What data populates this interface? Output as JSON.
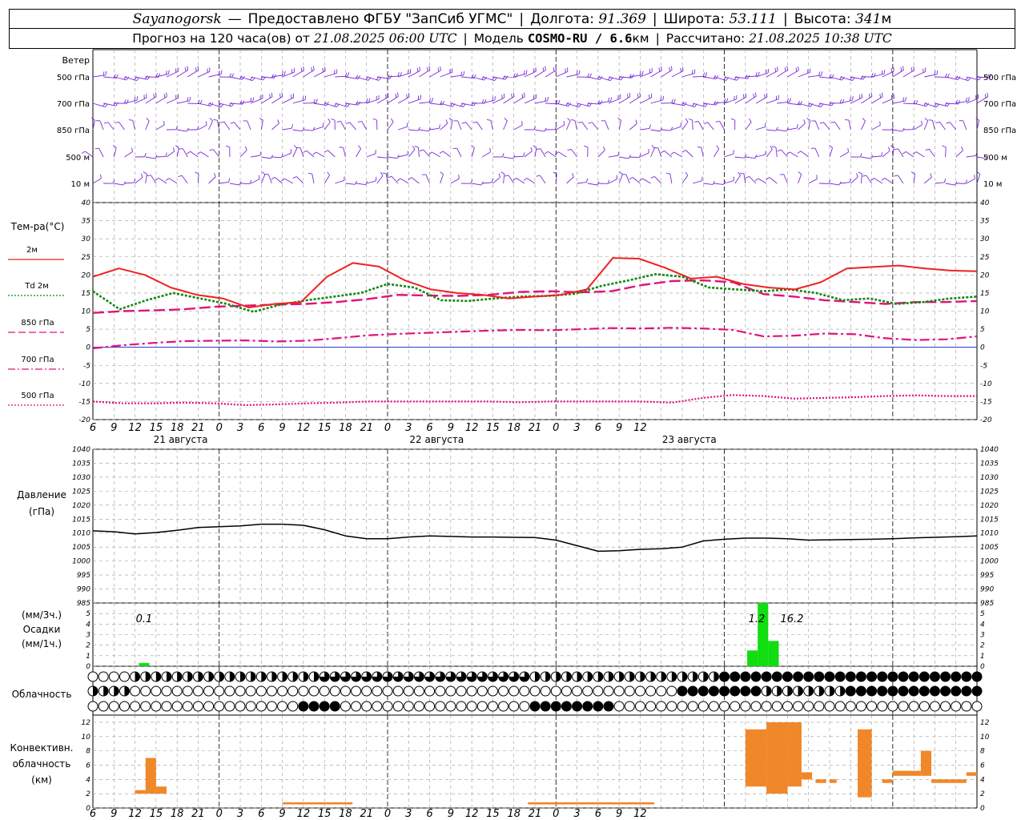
{
  "header": {
    "station": "Sayanogorsk",
    "dash": "—",
    "provider": "Предоставлено ФГБУ \"ЗапСиб УГМС\"",
    "lon_label": "Долгота:",
    "lon_value": "91.369",
    "lat_label": "Широта:",
    "lat_value": "53.111",
    "alt_label": "Высота:",
    "alt_value": "341",
    "alt_unit": "м",
    "forecast_prefix": "Прогноз на 120 часа(ов) от",
    "forecast_start": "21.08.2025 06:00 UTC",
    "model_label": "Модель",
    "model_name": "COSMO-RU / 6.6",
    "model_unit": "км",
    "computed_label": "Рассчитано:",
    "computed_value": "21.08.2025 10:38 UTC"
  },
  "panels": {
    "wind": {
      "title": "Ветер",
      "levels": [
        "500 гПа",
        "700 гПа",
        "850 гПа",
        "500 м",
        "10  м"
      ]
    },
    "temperature": {
      "title": "Тем-ра(°C)",
      "legend": [
        {
          "label": "2м",
          "color": "#ee2222",
          "style": "solid"
        },
        {
          "label": "Td 2м",
          "color": "#118811",
          "style": "dotted"
        },
        {
          "label": "850 гПа",
          "color": "#e0137a",
          "style": "dashed"
        },
        {
          "label": "700 гПа",
          "color": "#e0137a",
          "style": "dashdot"
        },
        {
          "label": "500 гПа",
          "color": "#e0137a",
          "style": "dotted"
        }
      ]
    },
    "pressure": {
      "title": "Давление",
      "unit": "(гПа)"
    },
    "precip": {
      "unit_top": "(мм/3ч.)",
      "title": "Осадки",
      "unit_bottom": "(мм/1ч.)",
      "annotations": [
        "0.1",
        "1.2",
        "16.2"
      ]
    },
    "clouds": {
      "title": "Облачность"
    },
    "convective": {
      "title": [
        "Конвективн.",
        "облачность",
        "(км)"
      ]
    }
  },
  "time_axis": {
    "tick_labels": [
      "6",
      "9",
      "12",
      "15",
      "18",
      "21",
      "0",
      "3",
      "6",
      "9",
      "12",
      "15",
      "18",
      "21",
      "0",
      "3",
      "6",
      "9",
      "12",
      "15",
      "18",
      "21",
      "0",
      "3",
      "6",
      "9",
      "12"
    ],
    "day_labels": [
      "21 августа",
      "22 августа",
      "23 августа"
    ]
  },
  "chart_data": [
    {
      "type": "line",
      "title": "Тем-ра(°C)",
      "ylim": [
        -20,
        40
      ],
      "yticks": [
        -20,
        -15,
        -10,
        -5,
        0,
        5,
        10,
        15,
        20,
        25,
        30,
        35,
        40
      ],
      "x_hours": [
        0,
        3,
        6,
        9,
        12,
        15,
        18,
        21,
        24,
        27,
        30,
        33,
        36,
        39,
        42,
        45,
        48,
        51,
        54,
        57,
        60,
        63,
        66,
        69,
        72,
        75,
        78,
        81,
        84,
        87,
        90,
        93,
        96,
        99,
        102,
        105,
        108,
        111,
        114,
        117,
        120,
        123,
        126
      ],
      "series": [
        {
          "name": "2м",
          "values": [
            19.5,
            21.8,
            20,
            16.5,
            14.5,
            13.5,
            11,
            12,
            12.5,
            19.5,
            23.3,
            22.3,
            18.5,
            16,
            15,
            14.5,
            13.5,
            14,
            14.5,
            16,
            24.7,
            24.5,
            22,
            19,
            19.5,
            17.5,
            16.5,
            16,
            18,
            21.8,
            22.2,
            22.6,
            21.8,
            21.2,
            21
          ]
        },
        {
          "name": "Td 2м",
          "values": [
            15.5,
            10.5,
            13,
            15,
            13.5,
            12,
            9.8,
            11.8,
            13,
            14,
            15,
            17.5,
            16.5,
            13,
            12.8,
            13.5,
            14,
            14.2,
            14.8,
            17,
            18.5,
            20.2,
            19.5,
            16.5,
            16,
            15.5,
            16,
            15,
            13,
            13.5,
            12,
            12.5,
            13.5,
            14
          ]
        },
        {
          "name": "850 гПа",
          "values": [
            9.5,
            10,
            10.2,
            10.5,
            11.2,
            11.5,
            11.8,
            12,
            12.5,
            13.3,
            14.5,
            14.3,
            14.2,
            14.5,
            15.3,
            15.5,
            15.2,
            15.5,
            17.2,
            18.3,
            18.5,
            18,
            14.7,
            14,
            13,
            12.5,
            12,
            12.5,
            12.5,
            12.8
          ]
        },
        {
          "name": "700 гПа",
          "values": [
            -0.3,
            0.6,
            1.2,
            1.7,
            1.8,
            1.9,
            1.6,
            1.8,
            2.5,
            3.3,
            3.7,
            4,
            4.3,
            4.6,
            4.8,
            4.7,
            5,
            5.3,
            5.2,
            5.4,
            5.2,
            4.8,
            3,
            3.2,
            3.8,
            3.6,
            2.5,
            2,
            2.2,
            3
          ]
        },
        {
          "name": "500 гПа",
          "values": [
            -15,
            -15.5,
            -15.5,
            -15.3,
            -15.5,
            -16,
            -15.8,
            -15.5,
            -15.3,
            -15,
            -15,
            -15,
            -15,
            -15,
            -15.2,
            -15,
            -15,
            -15,
            -15,
            -15.3,
            -14,
            -13.2,
            -13.5,
            -14.2,
            -14,
            -13.8,
            -13.5,
            -13.3,
            -13.5,
            -13.5
          ]
        }
      ]
    },
    {
      "type": "line",
      "title": "Давление",
      "ylabel": "(гПа)",
      "ylim": [
        985,
        1040
      ],
      "yticks": [
        985,
        990,
        995,
        1000,
        1005,
        1010,
        1015,
        1020,
        1025,
        1030,
        1035,
        1040
      ],
      "x_hours": [
        0,
        3,
        6,
        9,
        12,
        15,
        18,
        21,
        24,
        27,
        30,
        33,
        36,
        39,
        42,
        45,
        48,
        51,
        54,
        57,
        60,
        63,
        66,
        69,
        72,
        75,
        78,
        81,
        84,
        87,
        90,
        93,
        96,
        99,
        102,
        105,
        108,
        111,
        114,
        117,
        120,
        123,
        126
      ],
      "series": [
        {
          "name": "",
          "values": [
            1010.8,
            1010.5,
            1009.7,
            1010.2,
            1011,
            1012,
            1012.3,
            1012.6,
            1013.2,
            1013.2,
            1012.8,
            1011.2,
            1009,
            1008,
            1008,
            1008.6,
            1009,
            1008.8,
            1008.6,
            1008.6,
            1008.5,
            1008.4,
            1007.5,
            1005.5,
            1003.5,
            1003.7,
            1004.2,
            1004.4,
            1005,
            1007.2,
            1007.8,
            1008.2,
            1008.2,
            1008,
            1007.5,
            1007.6,
            1007.7,
            1007.8,
            1008,
            1008.3,
            1008.5,
            1008.7,
            1009
          ]
        }
      ]
    },
    {
      "type": "bar",
      "title": "Осадки",
      "ylim": [
        0,
        6
      ],
      "yticks": [
        0,
        1,
        2,
        3,
        4,
        5
      ],
      "bars": [
        {
          "hour": 7.3,
          "value": 0.3
        },
        {
          "hour": 94,
          "value": 1.5
        },
        {
          "hour": 95.5,
          "value": 6
        },
        {
          "hour": 97,
          "value": 2.4
        }
      ]
    },
    {
      "type": "bar",
      "title": "Конвективн. облачность (км)",
      "ylim": [
        0,
        13
      ],
      "yticks": [
        0,
        2,
        4,
        6,
        8,
        10,
        12
      ],
      "bars": [
        {
          "hour_from": 6,
          "hour_to": 7.5,
          "bottom": 2,
          "top": 2.5
        },
        {
          "hour_from": 7.5,
          "hour_to": 9,
          "bottom": 2,
          "top": 7
        },
        {
          "hour_from": 9,
          "hour_to": 10.5,
          "bottom": 2,
          "top": 3
        },
        {
          "hour_from": 27,
          "hour_to": 37,
          "bottom": 0.5,
          "top": 0.8
        },
        {
          "hour_from": 62,
          "hour_to": 80,
          "bottom": 0.5,
          "top": 0.8
        },
        {
          "hour_from": 93,
          "hour_to": 96,
          "bottom": 3,
          "top": 11
        },
        {
          "hour_from": 96,
          "hour_to": 99,
          "bottom": 2,
          "top": 12
        },
        {
          "hour_from": 99,
          "hour_to": 101,
          "bottom": 3,
          "top": 12
        },
        {
          "hour_from": 101,
          "hour_to": 102.5,
          "bottom": 4,
          "top": 5
        },
        {
          "hour_from": 103,
          "hour_to": 104.5,
          "bottom": 3.5,
          "top": 4
        },
        {
          "hour_from": 105,
          "hour_to": 106,
          "bottom": 3.5,
          "top": 4
        },
        {
          "hour_from": 109,
          "hour_to": 111,
          "bottom": 1.5,
          "top": 11
        },
        {
          "hour_from": 112.5,
          "hour_to": 114,
          "bottom": 3.5,
          "top": 4
        },
        {
          "hour_from": 114,
          "hour_to": 118,
          "bottom": 4.5,
          "top": 5.2
        },
        {
          "hour_from": 118,
          "hour_to": 119.5,
          "bottom": 4.5,
          "top": 8
        },
        {
          "hour_from": 119.5,
          "hour_to": 124.5,
          "bottom": 3.5,
          "top": 4
        },
        {
          "hour_from": 124.5,
          "hour_to": 126,
          "bottom": 4.5,
          "top": 5
        }
      ]
    }
  ],
  "colors": {
    "t2m": "#ee2222",
    "td": "#118811",
    "upper": "#e0137a",
    "zero_line": "#2233cc",
    "precip": "#11dd11",
    "convective": "#f0882a",
    "wind": "#7a2ad8",
    "grid": "#9a9a9a"
  }
}
